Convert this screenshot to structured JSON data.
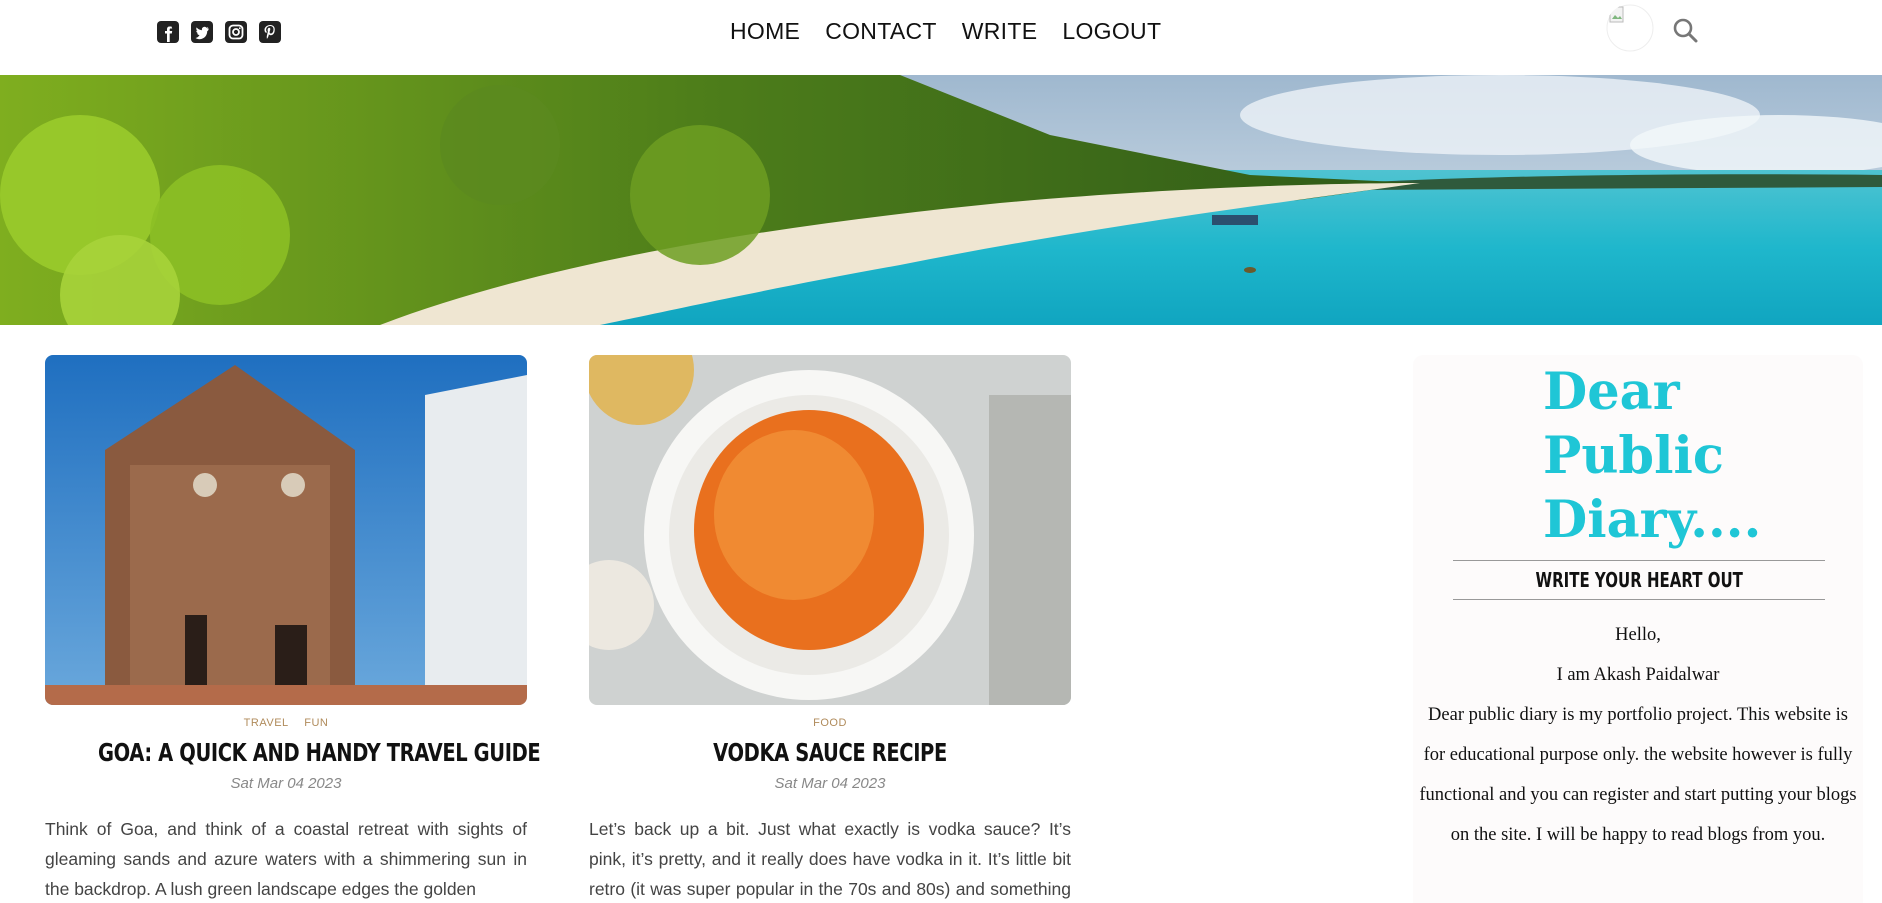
{
  "header": {
    "social": [
      {
        "icon": "facebook-square-icon"
      },
      {
        "icon": "twitter-square-icon"
      },
      {
        "icon": "instagram-square-icon"
      },
      {
        "icon": "pinterest-square-icon"
      }
    ],
    "nav": [
      "HOME",
      "CONTACT",
      "WRITE",
      "LOGOUT"
    ],
    "search_icon": "search-icon"
  },
  "hero": {
    "alt": "tropical beach banner"
  },
  "posts": [
    {
      "categories": [
        "TRAVEL",
        "FUN"
      ],
      "title": "GOA: A QUICK AND HANDY TRAVEL GUIDE",
      "date": "Sat Mar 04 2023",
      "excerpt": "Think of Goa, and think of a coastal retreat with sights of gleaming sands and azure waters with a shimmering sun in the backdrop. A lush green landscape edges the golden"
    },
    {
      "categories": [
        "FOOD"
      ],
      "title": "VODKA SAUCE RECIPE",
      "date": "Sat Mar 04 2023",
      "excerpt": "Let’s back up a bit. Just what exactly is vodka sauce? It’s pink, it’s pretty, and it really does have vodka in it. It’s little bit retro (it was super popular in the 70s and 80s) and something you"
    }
  ],
  "sidebar": {
    "title": "Dear Public Diary....",
    "subtitle": "WRITE YOUR HEART OUT",
    "greeting": "Hello,",
    "intro": "I am Akash Paidalwar",
    "about": "Dear public diary is my portfolio project. This website is for educational purpose only. the website however is fully functional and you can register and start putting your blogs on the site. I will be happy to read blogs from you."
  },
  "colors": {
    "brand_title": "#1fc6d6",
    "category": "#b08b5b",
    "date": "#888888"
  }
}
